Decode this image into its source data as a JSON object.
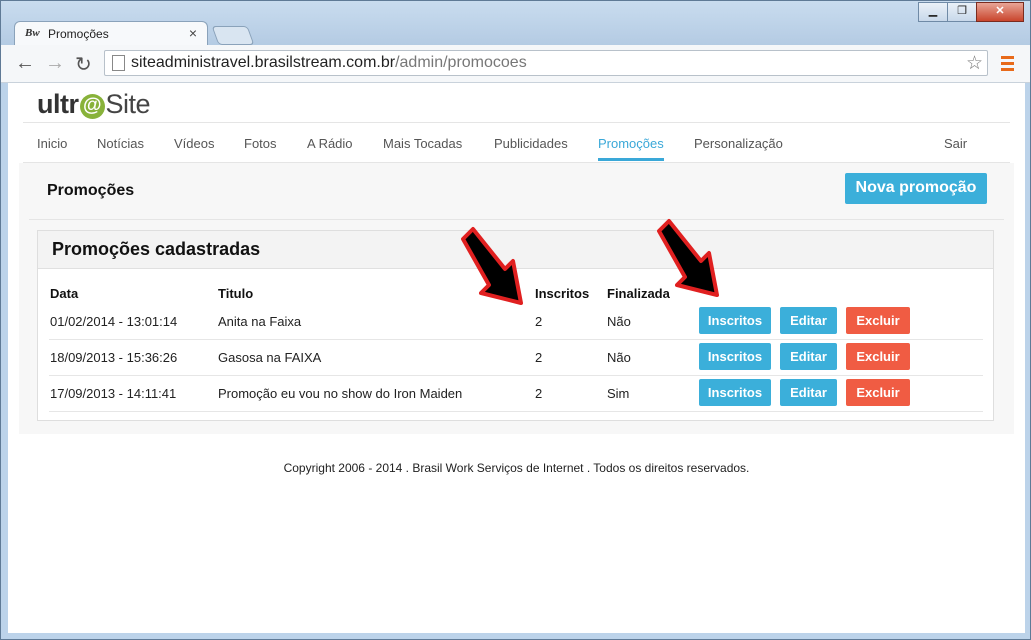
{
  "browser": {
    "tab_favicon": "Bw",
    "tab_title": "Promoções",
    "tab_close": "×",
    "url_host": "siteadministravel.brasilstream.com.br",
    "url_path": "/admin/promocoes",
    "window_buttons": [
      "▁",
      "❐",
      "✕"
    ]
  },
  "site": {
    "logo_left": "ultr",
    "logo_at": "@",
    "logo_right": "Site"
  },
  "nav": {
    "items": [
      "Inicio",
      "Notícias",
      "Vídeos",
      "Fotos",
      "A Rádio",
      "Mais Tocadas",
      "Publicidades",
      "Promoções",
      "Personalização"
    ],
    "active": "Promoções",
    "logout": "Sair"
  },
  "main": {
    "title": "Promoções",
    "new_button": "Nova promoção",
    "box_title": "Promoções cadastradas",
    "columns": [
      "Data",
      "Titulo",
      "Inscritos",
      "Finalizada"
    ],
    "rows": [
      {
        "date": "01/02/2014 - 13:01:14",
        "title": "Anita na Faixa",
        "subscribers": "2",
        "finished": "Não"
      },
      {
        "date": "18/09/2013 - 15:36:26",
        "title": "Gasosa na FAIXA",
        "subscribers": "2",
        "finished": "Não"
      },
      {
        "date": "17/09/2013 - 14:11:41",
        "title": "Promoção eu vou no show do Iron Maiden",
        "subscribers": "2",
        "finished": "Sim"
      }
    ],
    "actions": {
      "subscribers": "Inscritos",
      "edit": "Editar",
      "delete": "Excluir"
    }
  },
  "footer": "Copyright 2006 - 2014 . Brasil Work Serviços de Internet . Todos os direitos reservados.",
  "colors": {
    "accent": "#3bafda",
    "danger": "#f05c43",
    "logo_green": "#88b23a",
    "arrow": "#e02020"
  }
}
